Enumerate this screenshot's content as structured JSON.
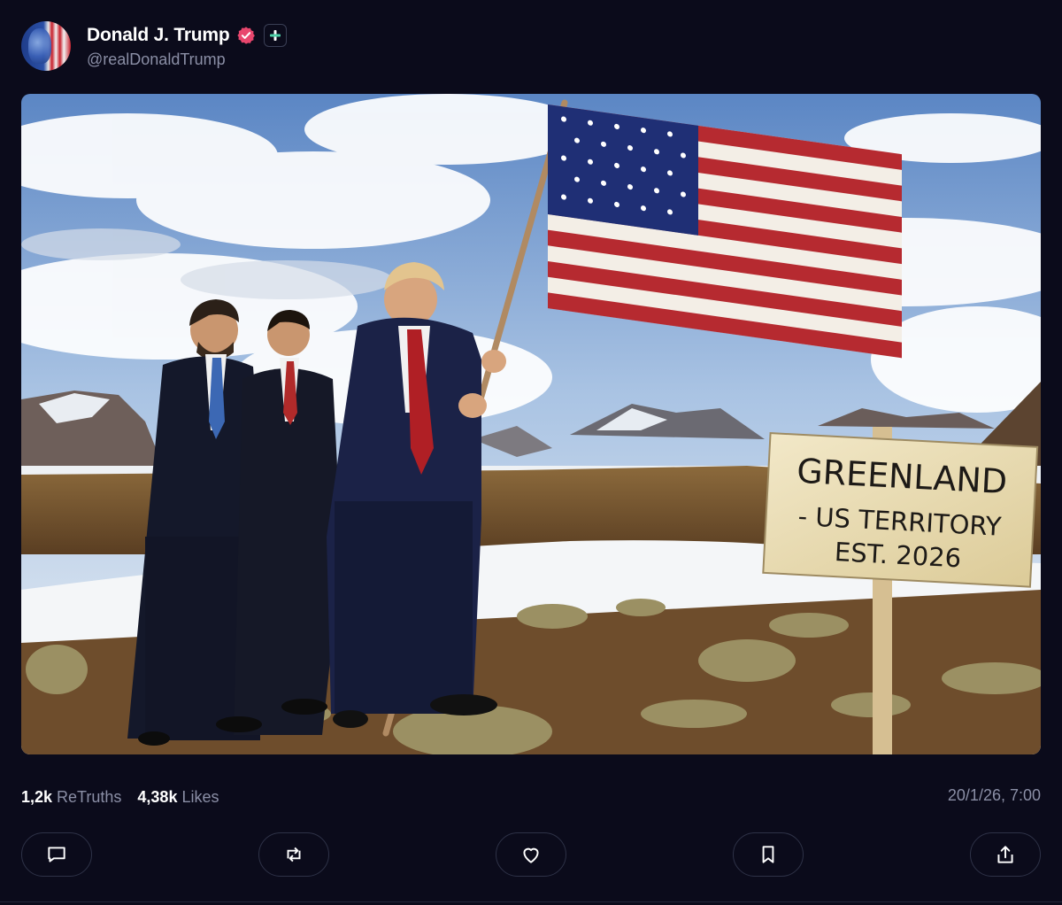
{
  "post": {
    "author": {
      "display_name": "Donald J. Trump",
      "handle": "@realDonaldTrump",
      "avatar_icon": "avatar-flag-portrait"
    },
    "image": {
      "sign_lines": [
        "GREENLAND",
        "- US TERRITORY",
        "EST. 2026"
      ]
    },
    "stats": {
      "retruths_count": "1,2k",
      "retruths_label": "ReTruths",
      "likes_count": "4,38k",
      "likes_label": "Likes"
    },
    "timestamp": "20/1/26, 7:00",
    "actions": [
      {
        "name": "reply",
        "icon": "comment-icon"
      },
      {
        "name": "retruth",
        "icon": "repost-icon"
      },
      {
        "name": "like",
        "icon": "heart-icon"
      },
      {
        "name": "bookmark",
        "icon": "bookmark-icon"
      },
      {
        "name": "share",
        "icon": "share-icon"
      }
    ]
  },
  "colors": {
    "background": "#0b0b1b",
    "muted_text": "#8b8fa6",
    "verified_badge": "#e8466d",
    "plus_badge": "#4fd1a8"
  }
}
